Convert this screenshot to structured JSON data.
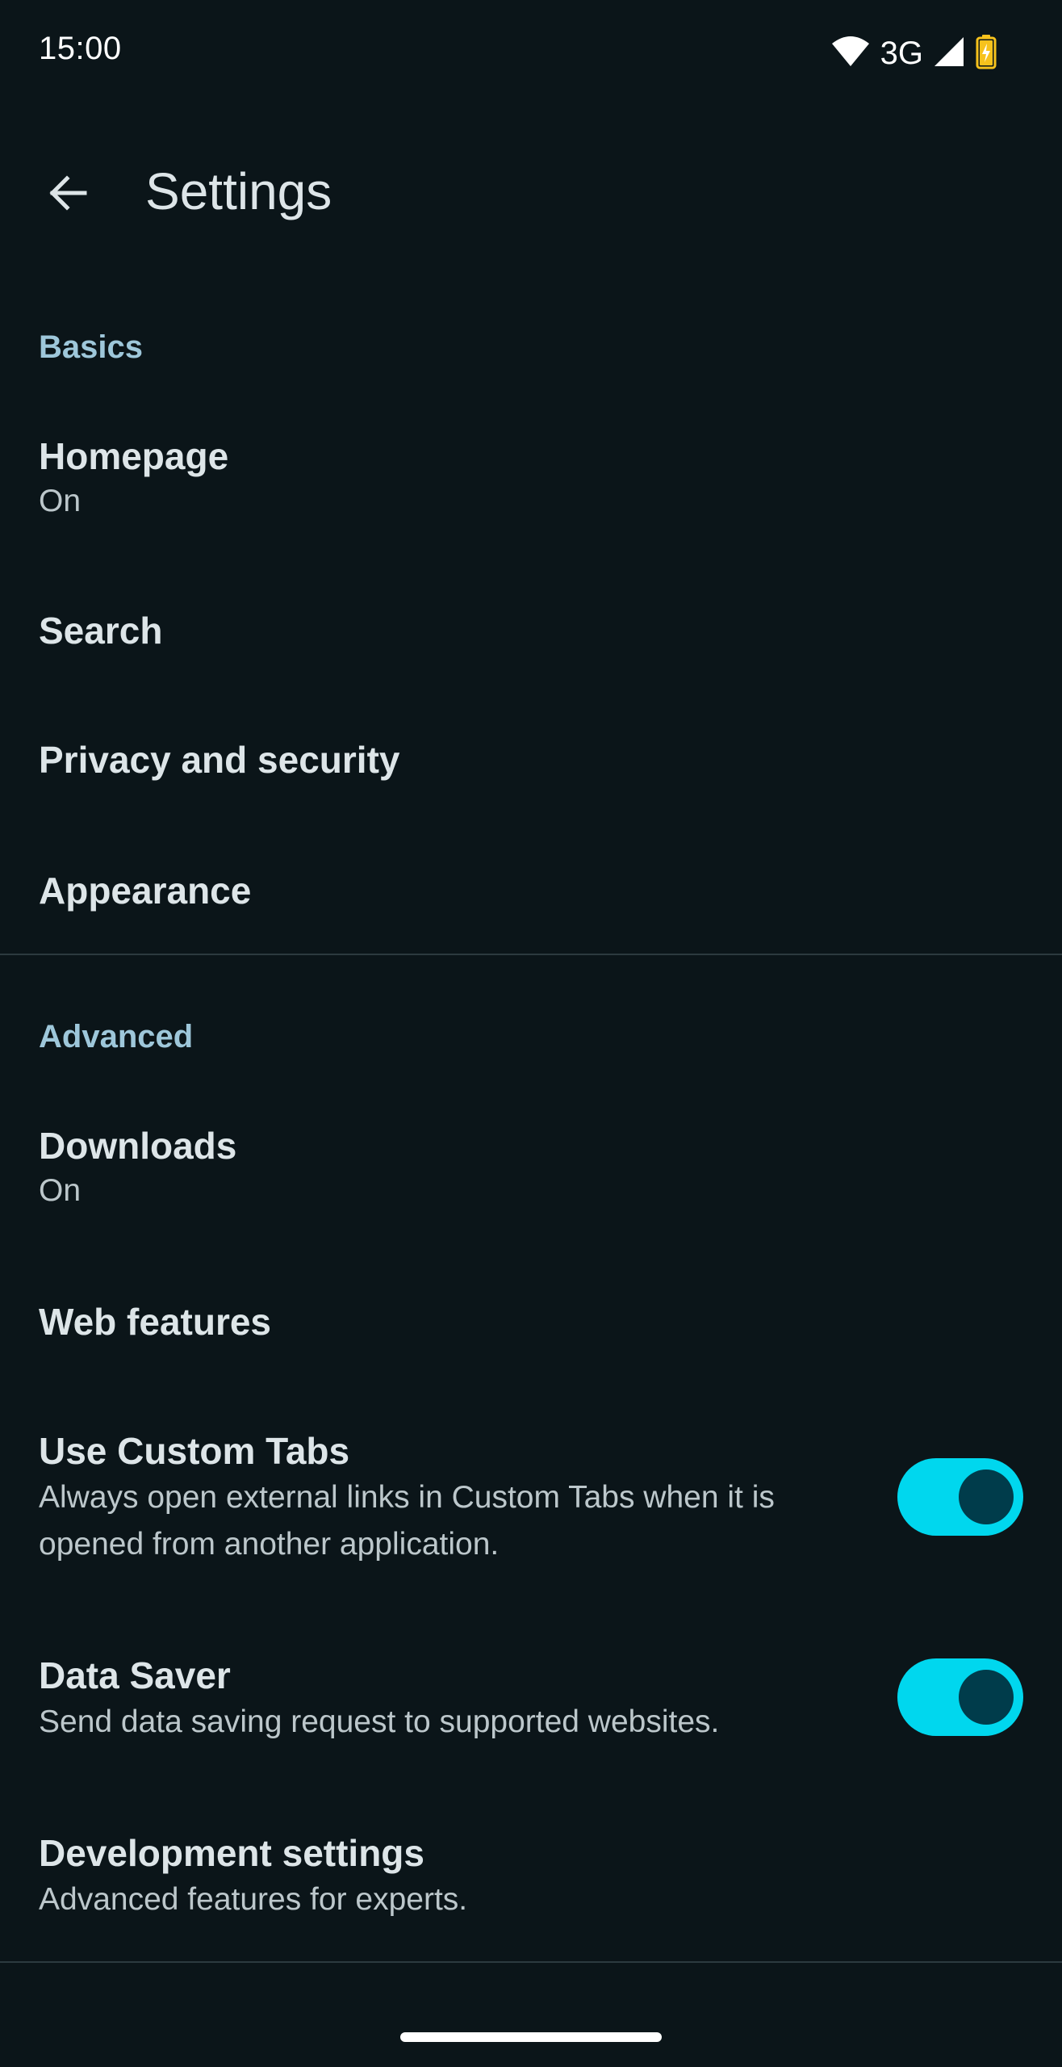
{
  "status_bar": {
    "time": "15:00",
    "network": "3G",
    "icons": [
      "wifi-icon",
      "signal-icon",
      "battery-charging-icon"
    ],
    "battery_color": "#f7c21c"
  },
  "app_bar": {
    "back_icon": "arrow-back-icon",
    "title": "Settings"
  },
  "sections": {
    "basics": {
      "header": "Basics",
      "homepage": {
        "title": "Homepage",
        "summary": "On"
      },
      "search": {
        "title": "Search"
      },
      "privacy": {
        "title": "Privacy and security"
      },
      "appearance": {
        "title": "Appearance"
      }
    },
    "advanced": {
      "header": "Advanced",
      "downloads": {
        "title": "Downloads",
        "summary": "On"
      },
      "web_features": {
        "title": "Web features"
      },
      "custom_tabs": {
        "title": "Use Custom Tabs",
        "summary": "Always open external links in Custom Tabs when it is opened from another application.",
        "enabled": true
      },
      "data_saver": {
        "title": "Data Saver",
        "summary": "Send data saving request to supported websites.",
        "enabled": true
      },
      "development": {
        "title": "Development settings",
        "summary": "Advanced features for experts."
      }
    }
  },
  "colors": {
    "background": "#0b1519",
    "accent": "#00d7ee",
    "section_header": "#9ec7da",
    "switch_thumb": "#003c4b"
  }
}
